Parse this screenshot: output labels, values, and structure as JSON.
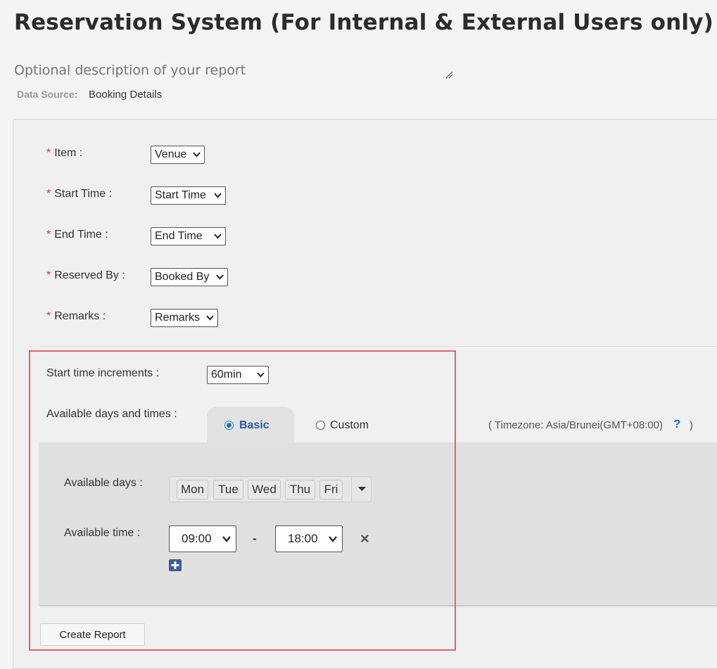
{
  "page": {
    "title": "Reservation System (For Internal & External Users only)",
    "description_placeholder": "Optional description of your report",
    "data_source_label": "Data Source:",
    "data_source_value": "Booking Details"
  },
  "fields": {
    "item": {
      "label": "Item :",
      "value": "Venue"
    },
    "start_time": {
      "label": "Start Time :",
      "value": "Start Time"
    },
    "end_time": {
      "label": "End Time :",
      "value": "End Time"
    },
    "reserved_by": {
      "label": "Reserved By :",
      "value": "Booked By"
    },
    "remarks": {
      "label": "Remarks :",
      "value": "Remarks"
    },
    "required_mark": "*"
  },
  "increments": {
    "label": "Start time increments :",
    "value": "60min"
  },
  "availability": {
    "label": "Available days and times :",
    "tab_basic": "Basic",
    "tab_custom": "Custom",
    "timezone_text": "( Timezone: Asia/Brunei(GMT+08:00)",
    "help_glyph": "?",
    "timezone_close": ")",
    "days_label": "Available days :",
    "days": [
      "Mon",
      "Tue",
      "Wed",
      "Thu",
      "Fri"
    ],
    "time_label": "Available time :",
    "time_start": "09:00",
    "time_separator": "-",
    "time_end": "18:00",
    "remove_glyph": "×"
  },
  "buttons": {
    "create_report": "Create Report"
  },
  "icons": {
    "resize": "resize-handle-icon",
    "chevron": "chevron-down-icon",
    "help": "help-icon",
    "remove": "close-icon",
    "add": "plus-square-icon",
    "dropdown": "caret-down-icon"
  },
  "colors": {
    "required": "#d9322b",
    "accent": "#1a6fd0",
    "add_icon": "#3a5f9a",
    "highlight": "#e8606a"
  }
}
